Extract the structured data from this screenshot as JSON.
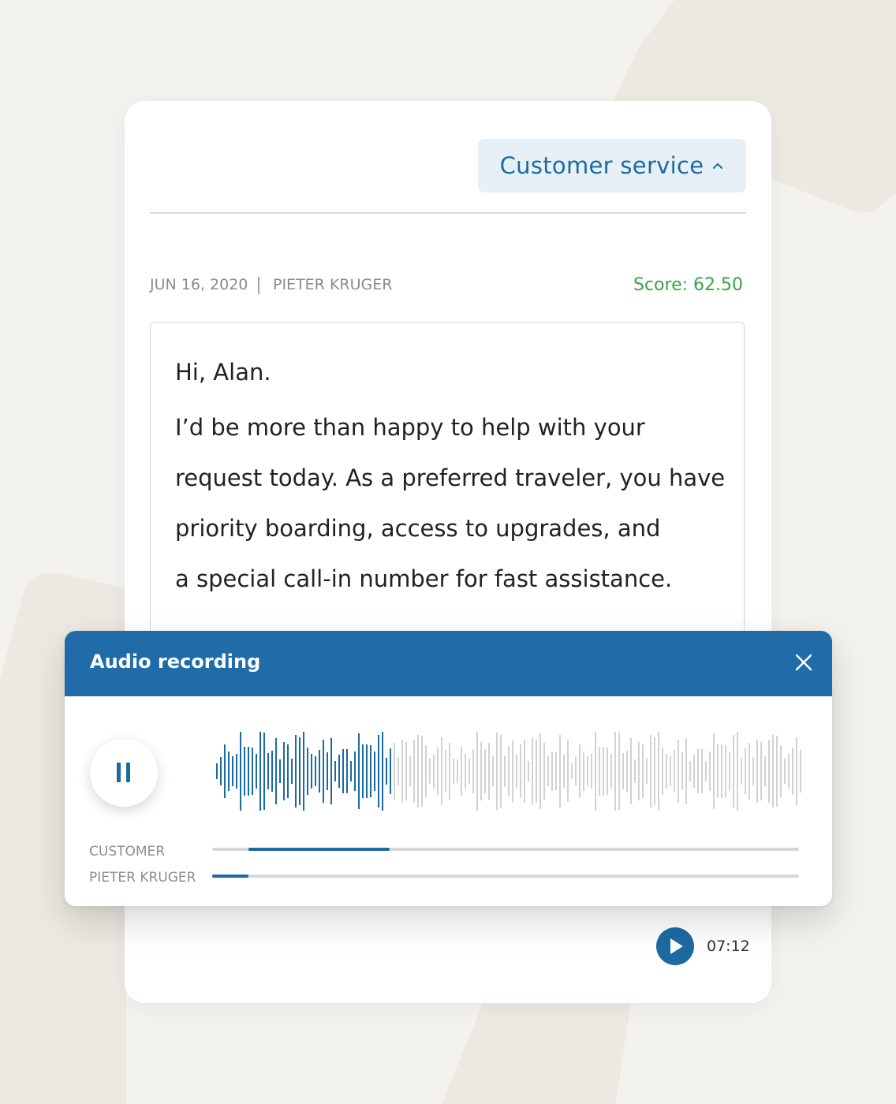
{
  "category": {
    "label": "Customer service",
    "icon": "chevron-up-icon"
  },
  "conversation": {
    "date": "JUN 16, 2020",
    "agent": "PIETER KRUGER",
    "score": "Score: 62.50"
  },
  "message": {
    "greeting": "Hi, Alan.",
    "lines": [
      "I’d be more than happy to help with your",
      "request today. As a preferred traveler, you have",
      "priority boarding, access to upgrades, and",
      "a special call-in number for fast assistance."
    ]
  },
  "audio_panel": {
    "title": "Audio recording",
    "close_icon": "close-icon",
    "control_icon": "pause-icon",
    "playback_progress": 0.3,
    "tracks": [
      {
        "label": "CUSTOMER",
        "segment_start": 0.062,
        "segment_end": 0.302
      },
      {
        "label": "PIETER KRUGER",
        "segment_start": 0.0,
        "segment_end": 0.062
      }
    ]
  },
  "footer": {
    "play_icon": "play-icon",
    "duration": "07:12"
  },
  "colors": {
    "accent": "#1c6aa2",
    "header": "#1f6ca9",
    "score": "#3aa24a",
    "chip_background": "#e6f0f6",
    "waveform_played": "#1c6aa2",
    "waveform_unplayed": "#d2d2d2"
  }
}
